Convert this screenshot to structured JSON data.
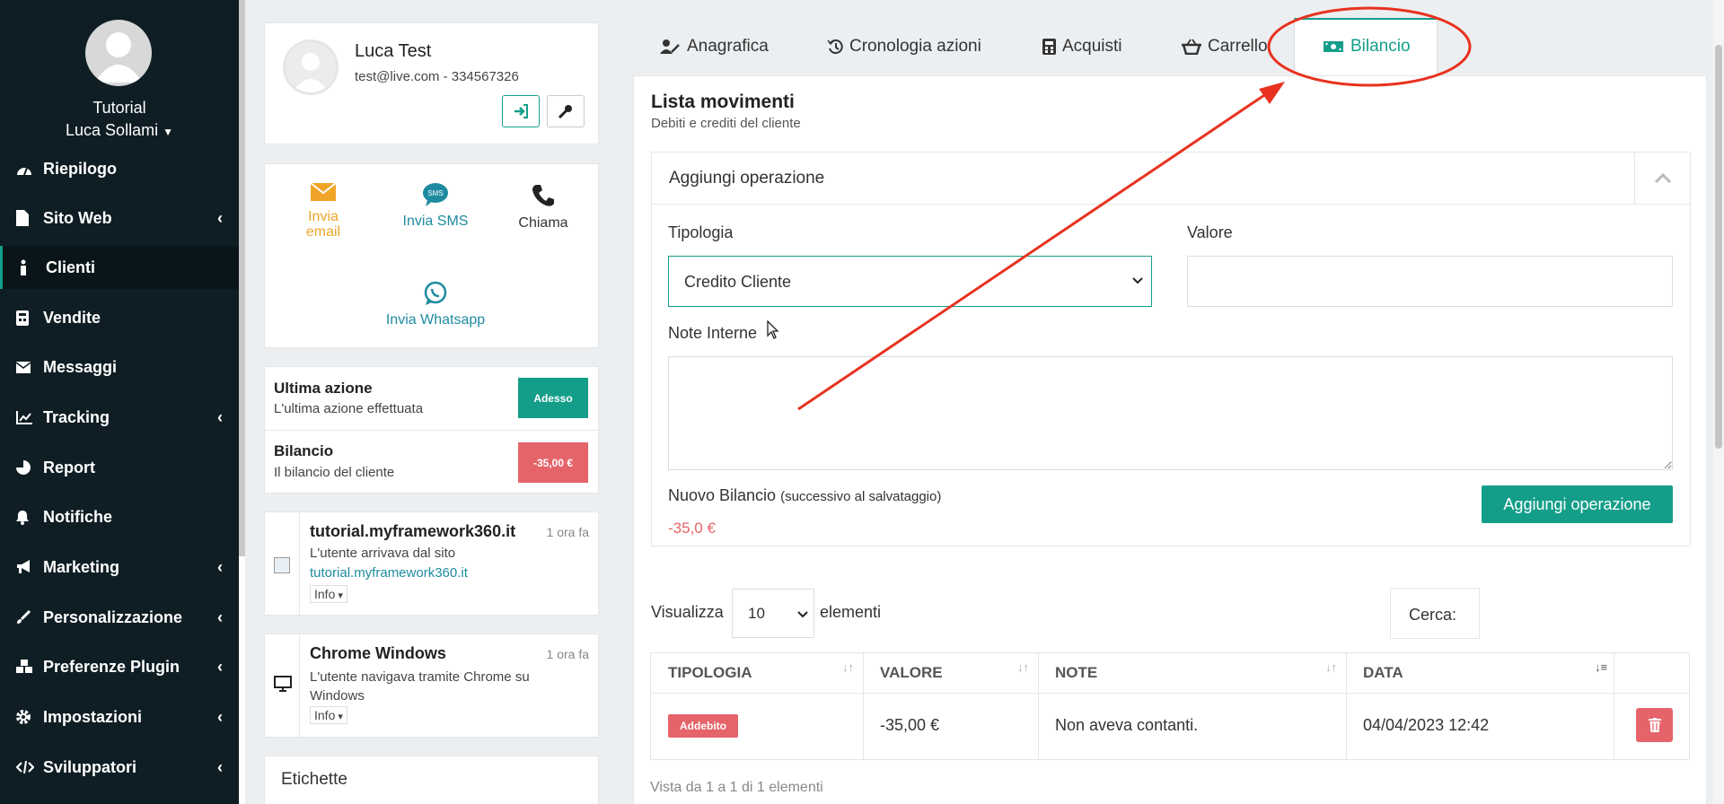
{
  "sidebar": {
    "account": "Tutorial",
    "user": "Luca Sollami",
    "items": [
      {
        "label": "Riepilogo",
        "icon": "dashboard-icon",
        "chevron": false
      },
      {
        "label": "Sito Web",
        "icon": "file-icon",
        "chevron": true
      },
      {
        "label": "Clienti",
        "icon": "person-icon",
        "chevron": false,
        "active": true
      },
      {
        "label": "Vendite",
        "icon": "calculator-icon",
        "chevron": false
      },
      {
        "label": "Messaggi",
        "icon": "envelope-icon",
        "chevron": false
      },
      {
        "label": "Tracking",
        "icon": "chart-line-icon",
        "chevron": true
      },
      {
        "label": "Report",
        "icon": "pie-chart-icon",
        "chevron": false
      },
      {
        "label": "Notifiche",
        "icon": "bell-icon",
        "chevron": false
      },
      {
        "label": "Marketing",
        "icon": "megaphone-icon",
        "chevron": true
      },
      {
        "label": "Personalizzazione",
        "icon": "brush-icon",
        "chevron": true
      },
      {
        "label": "Preferenze Plugin",
        "icon": "cubes-icon",
        "chevron": true
      },
      {
        "label": "Impostazioni",
        "icon": "cog-icon",
        "chevron": true
      },
      {
        "label": "Sviluppatori",
        "icon": "code-icon",
        "chevron": true
      }
    ]
  },
  "profile": {
    "name": "Luca Test",
    "contact": "test@live.com - 334567326"
  },
  "contact_actions": {
    "email": "Invia email",
    "sms": "Invia SMS",
    "call": "Chiama",
    "whatsapp": "Invia Whatsapp"
  },
  "summary": {
    "last_action": {
      "title": "Ultima azione",
      "subtitle": "L'ultima azione effettuata",
      "badge": "Adesso"
    },
    "balance": {
      "title": "Bilancio",
      "subtitle": "Il bilancio del cliente",
      "badge": "-35,00 €"
    }
  },
  "timeline": [
    {
      "title": "tutorial.myframework360.it",
      "time": "1 ora fa",
      "text": "L'utente arrivava dal sito",
      "link": "tutorial.myframework360.it",
      "info": "Info"
    },
    {
      "title": "Chrome Windows",
      "time": "1 ora fa",
      "text": "L'utente navigava tramite Chrome su Windows",
      "info": "Info"
    }
  ],
  "labels_card": {
    "title": "Etichette"
  },
  "tabs": [
    "Anagrafica",
    "Cronologia azioni",
    "Acquisti",
    "Carrello",
    "Bilancio"
  ],
  "panel": {
    "title": "Lista movimenti",
    "subtitle": "Debiti e crediti del cliente"
  },
  "form": {
    "header": "Aggiungi operazione",
    "tipologia_label": "Tipologia",
    "tipologia_value": "Credito Cliente",
    "valore_label": "Valore",
    "valore_value": "",
    "note_label": "Note Interne",
    "note_value": "",
    "balance_label": "Nuovo Bilancio",
    "balance_hint": "(successivo al salvataggio)",
    "balance_value": "-35,0 €",
    "submit": "Aggiungi operazione"
  },
  "table_controls": {
    "show": "Visualizza",
    "length": "10",
    "elements": "elementi",
    "search_label": "Cerca:",
    "search_value": ""
  },
  "table": {
    "headers": [
      "Tipologia",
      "Valore",
      "Note",
      "Data"
    ],
    "rows": [
      {
        "tipologia": "Addebito",
        "valore": "-35,00 €",
        "note": "Non aveva contanti.",
        "data": "04/04/2023 12:42"
      }
    ],
    "info": "Vista da 1 a 1 di 1 elementi"
  },
  "colors": {
    "accent": "#149e8a",
    "danger": "#e5646a",
    "annotation": "#e8321f",
    "sidebar": "#0f1e24"
  }
}
